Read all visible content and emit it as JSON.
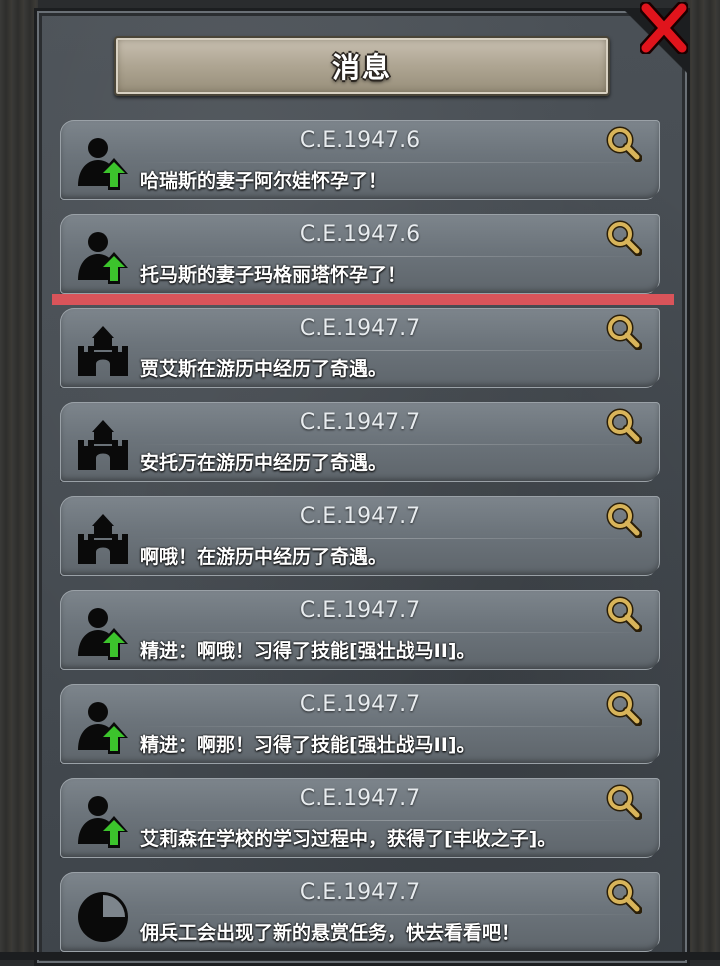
{
  "header": {
    "title": "消息",
    "close_icon": "close-x-icon"
  },
  "colors": {
    "accent_red": "#d9545a",
    "close_red": "#e0141c",
    "arrow_green": "#3cc42c",
    "search_gold": "#d8b45a"
  },
  "messages": [
    {
      "date": "C.E.1947.6",
      "text": "哈瑞斯的妻子阿尔娃怀孕了！",
      "icon": "person-up-arrow-icon"
    },
    {
      "date": "C.E.1947.6",
      "text": "托马斯的妻子玛格丽塔怀孕了！",
      "icon": "person-up-arrow-icon"
    },
    {
      "date": "C.E.1947.7",
      "text": "贾艾斯在游历中经历了奇遇。",
      "icon": "castle-icon"
    },
    {
      "date": "C.E.1947.7",
      "text": "安托万在游历中经历了奇遇。",
      "icon": "castle-icon"
    },
    {
      "date": "C.E.1947.7",
      "text": "啊哦！在游历中经历了奇遇。",
      "icon": "castle-icon"
    },
    {
      "date": "C.E.1947.7",
      "text": "精进：啊哦！习得了技能[强壮战马II]。",
      "icon": "person-up-arrow-icon"
    },
    {
      "date": "C.E.1947.7",
      "text": "精进：啊那！习得了技能[强壮战马II]。",
      "icon": "person-up-arrow-icon"
    },
    {
      "date": "C.E.1947.7",
      "text": "艾莉森在学校的学习过程中，获得了[丰收之子]。",
      "icon": "person-up-arrow-icon"
    },
    {
      "date": "C.E.1947.7",
      "text": "佣兵工会出现了新的悬赏任务，快去看看吧！",
      "icon": "clock-pie-icon"
    }
  ]
}
